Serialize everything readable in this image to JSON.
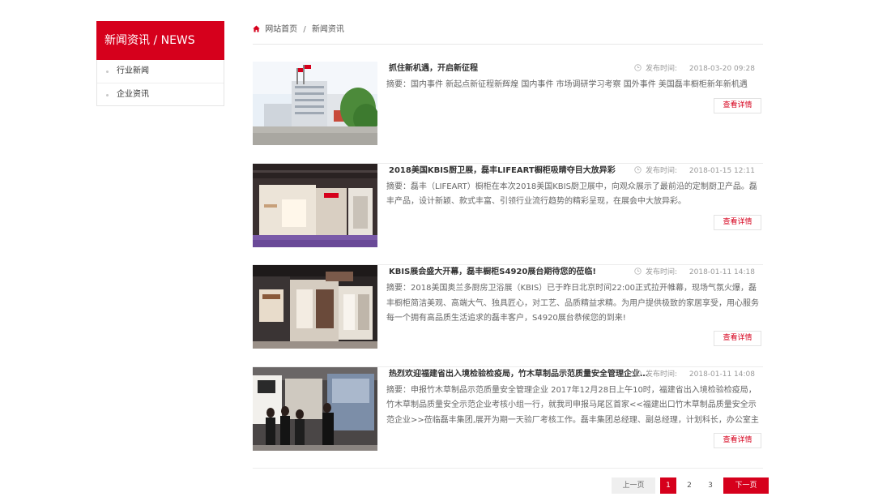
{
  "sidebar": {
    "title": "新闻资讯 / NEWS",
    "items": [
      {
        "label": "行业新闻"
      },
      {
        "label": "企业资讯"
      }
    ]
  },
  "breadcrumb": {
    "home": "网站首页",
    "separator": "/",
    "current": "新闻资讯"
  },
  "news": [
    {
      "title": "抓住新机遇，开启新征程",
      "date_label": "发布时间:",
      "date": "2018-03-20 09:28",
      "summary": "摘要：国内事件 新起点新征程新辉煌 国内事件 市场调研学习考察 国外事件 美国磊丰橱柜新年新机遇",
      "button": "查看详情",
      "image": "factory-building-photo"
    },
    {
      "title": "2018美国KBIS厨卫展，磊丰LIFEART橱柜吸睛夺目大放异彩",
      "date_label": "发布时间:",
      "date": "2018-01-15 12:11",
      "summary": "摘要：磊丰（LIFEART）橱柜在本次2018美国KBIS厨卫展中，向观众展示了最前沿的定制厨卫产品。磊丰产品，设计新颖、款式丰富、引领行业流行趋势的精彩呈现，在展会中大放异彩。",
      "button": "查看详情",
      "image": "exhibition-booth-photo"
    },
    {
      "title": "KBIS展会盛大开幕，磊丰橱柜S4920展台期待您的莅临!",
      "date_label": "发布时间:",
      "date": "2018-01-11 14:18",
      "summary": "摘要：2018美国奥兰多厨房卫浴展（KBIS）已于昨日北京时间22:00正式拉开帷幕，现场气氛火爆，磊丰橱柜简洁美观、高端大气、独具匠心，对工艺、品质精益求精。为用户提供极致的家居享受，用心服务每一个拥有高品质生活追求的磊丰客户，S4920展台恭候您的到来!",
      "button": "查看详情",
      "image": "booth-interior-photo"
    },
    {
      "title": "热烈欢迎福建省出入境检验检疫局，竹木草制品示范质量安全管理企业考...",
      "date_label": "发布时间:",
      "date": "2018-01-11 14:08",
      "summary": "摘要：申报竹木草制品示范质量安全管理企业  2017年12月28日上午10时，福建省出入境检验检疫局，竹木草制品质量安全示范企业考核小组一行，就我司申报马尾区首家<<福建出口竹木草制品质量安全示范企业>>莅临磊丰集团,展开为期一天验厂考核工作。磊丰集团总经理、副总经理，计划科长，办公室主任，等陪同参...",
      "button": "查看详情",
      "image": "visitors-group-photo"
    }
  ],
  "pagination": {
    "prev": "上一页",
    "pages": [
      "1",
      "2",
      "3"
    ],
    "active": "1",
    "next": "下一页"
  },
  "colors": {
    "accent": "#d6001c",
    "text": "#333333",
    "muted": "#999999"
  }
}
